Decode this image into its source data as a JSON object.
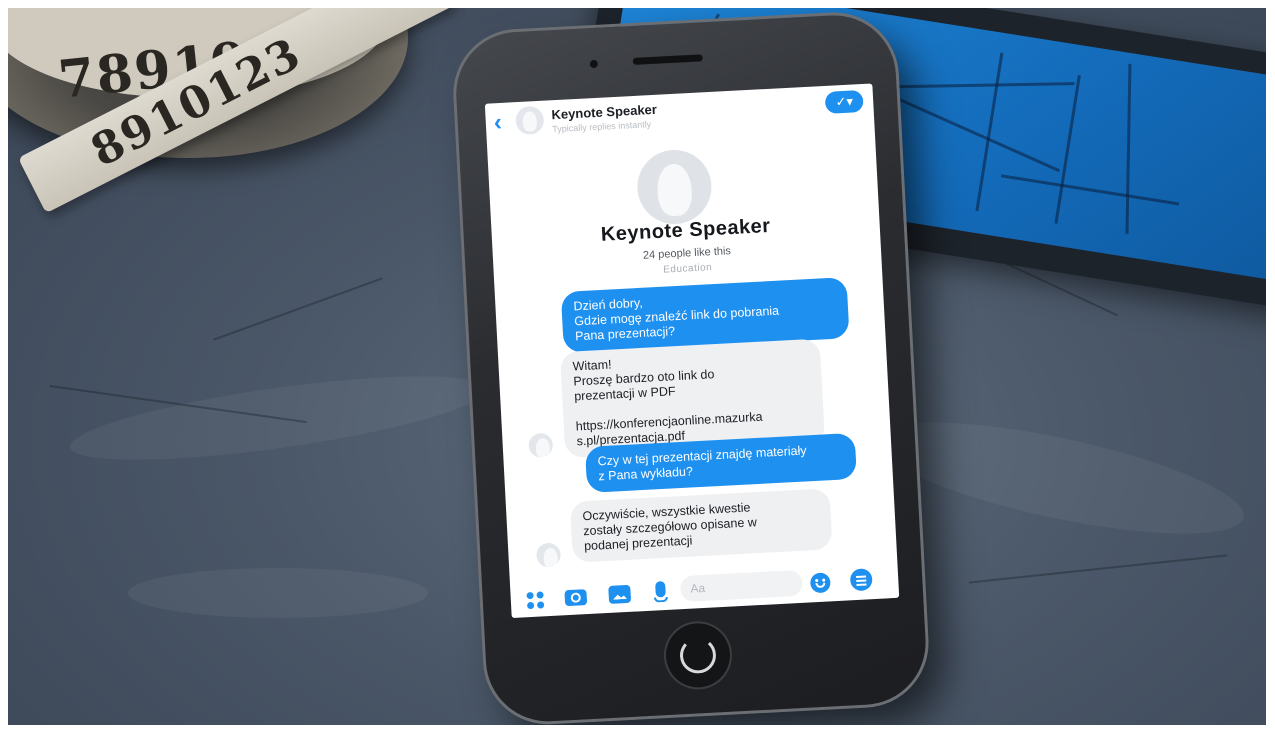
{
  "header": {
    "title": "Keynote Speaker",
    "subtitle": "Typically replies instantly"
  },
  "profile": {
    "name": "Keynote Speaker",
    "likes": "24 people like this",
    "category": "Education"
  },
  "messages": [
    {
      "from": "user",
      "text": "Dzień dobry,\nGdzie mogę znaleźć link do pobrania\nPana prezentacji?"
    },
    {
      "from": "page",
      "text": "Witam!\nProszę bardzo oto link do\nprezentacji w PDF\n\nhttps://konferencjaonline.mazurka\ns.pl/prezentacja.pdf"
    },
    {
      "from": "user",
      "text": "Czy w tej prezentacji znajdę materiały\nz Pana wykładu?"
    },
    {
      "from": "page",
      "text": "Oczywiście, wszystkie kwestie\nzostały szczegółowo opisane w\npodanej prezentacji"
    }
  ],
  "composer": {
    "placeholder": "Aa"
  },
  "tape": {
    "roll_digits": "789101",
    "strip_digits": "8910123"
  },
  "colors": {
    "accent": "#1e90f0",
    "incoming_bubble": "#eef0f2",
    "background_slate": "#4a5768"
  },
  "icons": {
    "back": "chevron-left-icon",
    "confirm": "check-icon",
    "apps": "apps-grid-icon",
    "camera": "camera-icon",
    "image": "image-icon",
    "mic": "microphone-icon",
    "emoji": "emoji-icon",
    "menu": "menu-icon"
  }
}
